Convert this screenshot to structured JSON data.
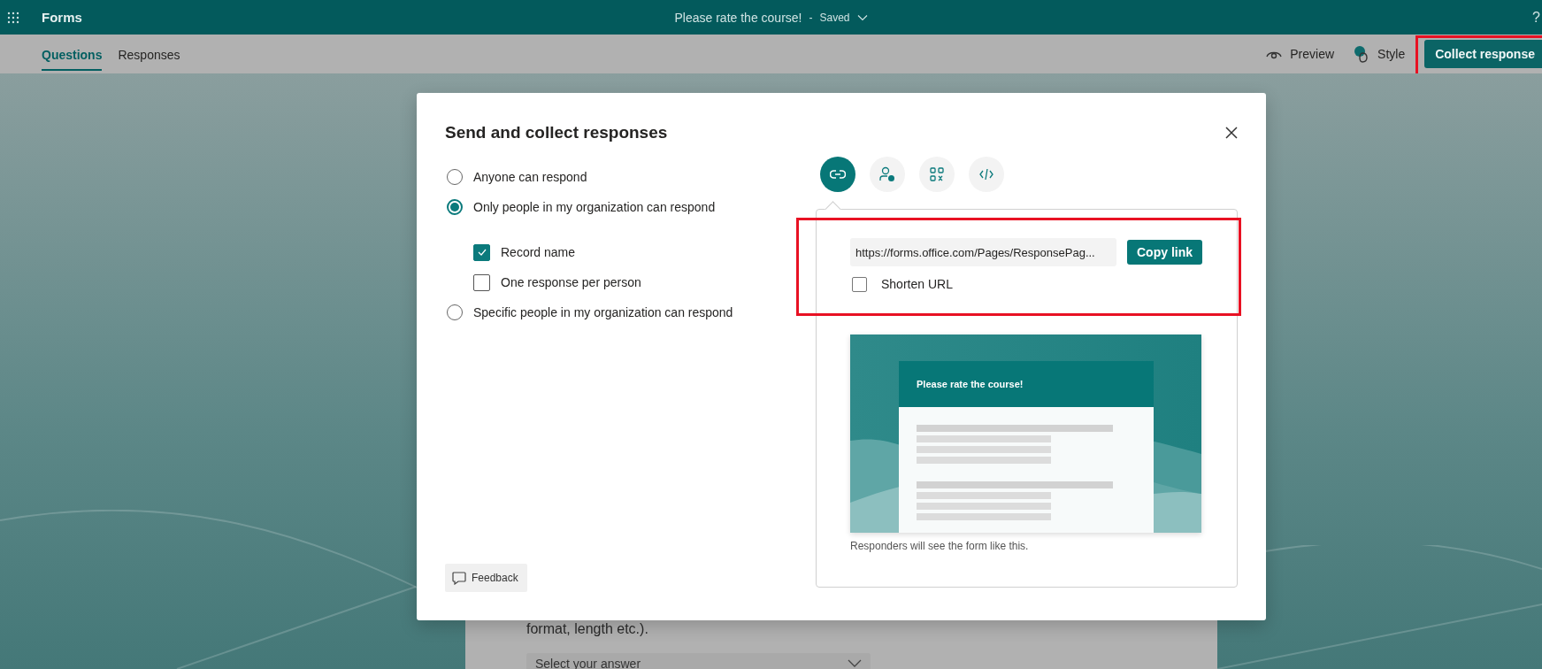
{
  "app": {
    "name": "Forms",
    "form_title": "Please rate the course!",
    "separator": "-",
    "save_status": "Saved",
    "help": "?"
  },
  "tabs": [
    {
      "label": "Questions",
      "selected": true
    },
    {
      "label": "Responses",
      "selected": false
    }
  ],
  "toolbar": {
    "preview": "Preview",
    "style": "Style",
    "collect": "Collect response"
  },
  "dialog": {
    "title": "Send and collect responses",
    "audience": [
      {
        "label": "Anyone can respond",
        "selected": false
      },
      {
        "label": "Only people in my organization can respond",
        "selected": true,
        "options": [
          {
            "label": "Record name",
            "checked": true
          },
          {
            "label": "One response per person",
            "checked": false
          }
        ]
      },
      {
        "label": "Specific people in my organization can respond",
        "selected": false
      }
    ],
    "share_methods": [
      {
        "kind": "link",
        "selected": true
      },
      {
        "kind": "person",
        "selected": false
      },
      {
        "kind": "qr",
        "selected": false
      },
      {
        "kind": "embed",
        "selected": false
      }
    ],
    "link": {
      "url": "https://forms.office.com/Pages/ResponsePag...",
      "copy_button": "Copy link",
      "shorten": {
        "label": "Shorten URL",
        "checked": false
      }
    },
    "preview": {
      "form_title": "Please rate the course!",
      "caption": "Responders will see the form like this."
    },
    "feedback": "Feedback"
  },
  "background_form": {
    "text": "format, length etc.).",
    "dropdown_placeholder": "Select your answer"
  }
}
